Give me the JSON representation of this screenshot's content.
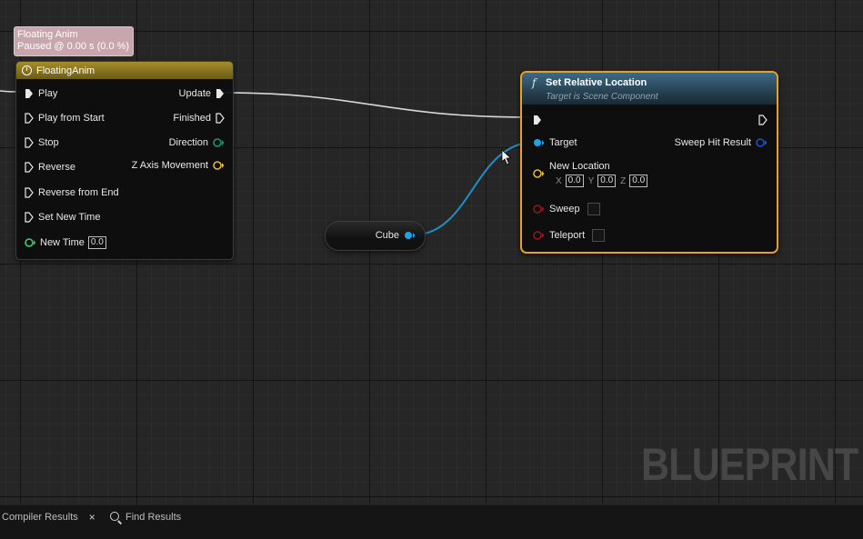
{
  "tooltip": {
    "line1": "Floating Anim",
    "line2": "Paused @ 0.00 s (0.0 %)"
  },
  "timeline_node": {
    "title": "FloatingAnim",
    "inputs": [
      {
        "label": "Play"
      },
      {
        "label": "Play from Start"
      },
      {
        "label": "Stop"
      },
      {
        "label": "Reverse"
      },
      {
        "label": "Reverse from End"
      },
      {
        "label": "Set New Time"
      },
      {
        "label": "New Time",
        "value": "0.0"
      }
    ],
    "outputs": [
      {
        "label": "Update"
      },
      {
        "label": "Finished"
      },
      {
        "label": "Direction"
      },
      {
        "label": "Z Axis Movement"
      }
    ]
  },
  "cube_node": {
    "label": "Cube"
  },
  "set_node": {
    "title": "Set Relative Location",
    "subtitle": "Target is Scene Component",
    "target_label": "Target",
    "sweep_hit_label": "Sweep Hit Result",
    "new_location_label": "New Location",
    "x_label": "X",
    "x_value": "0.0",
    "y_label": "Y",
    "y_value": "0.0",
    "z_label": "Z",
    "z_value": "0.0",
    "sweep_label": "Sweep",
    "teleport_label": "Teleport"
  },
  "watermark": "BLUEPRINT",
  "bottom_bar": {
    "compiler_results": "Compiler Results",
    "close": "×",
    "find_results": "Find Results"
  },
  "colors": {
    "timeline_header": "#a58d2a",
    "function_header": "#3d6a86",
    "selection_outline": "#e9a123",
    "object_pin": "#1fa3e8",
    "vector_pin": "#e5b83a",
    "bool_pin": "#8f1a1a",
    "float_pin": "#3bd16a"
  }
}
